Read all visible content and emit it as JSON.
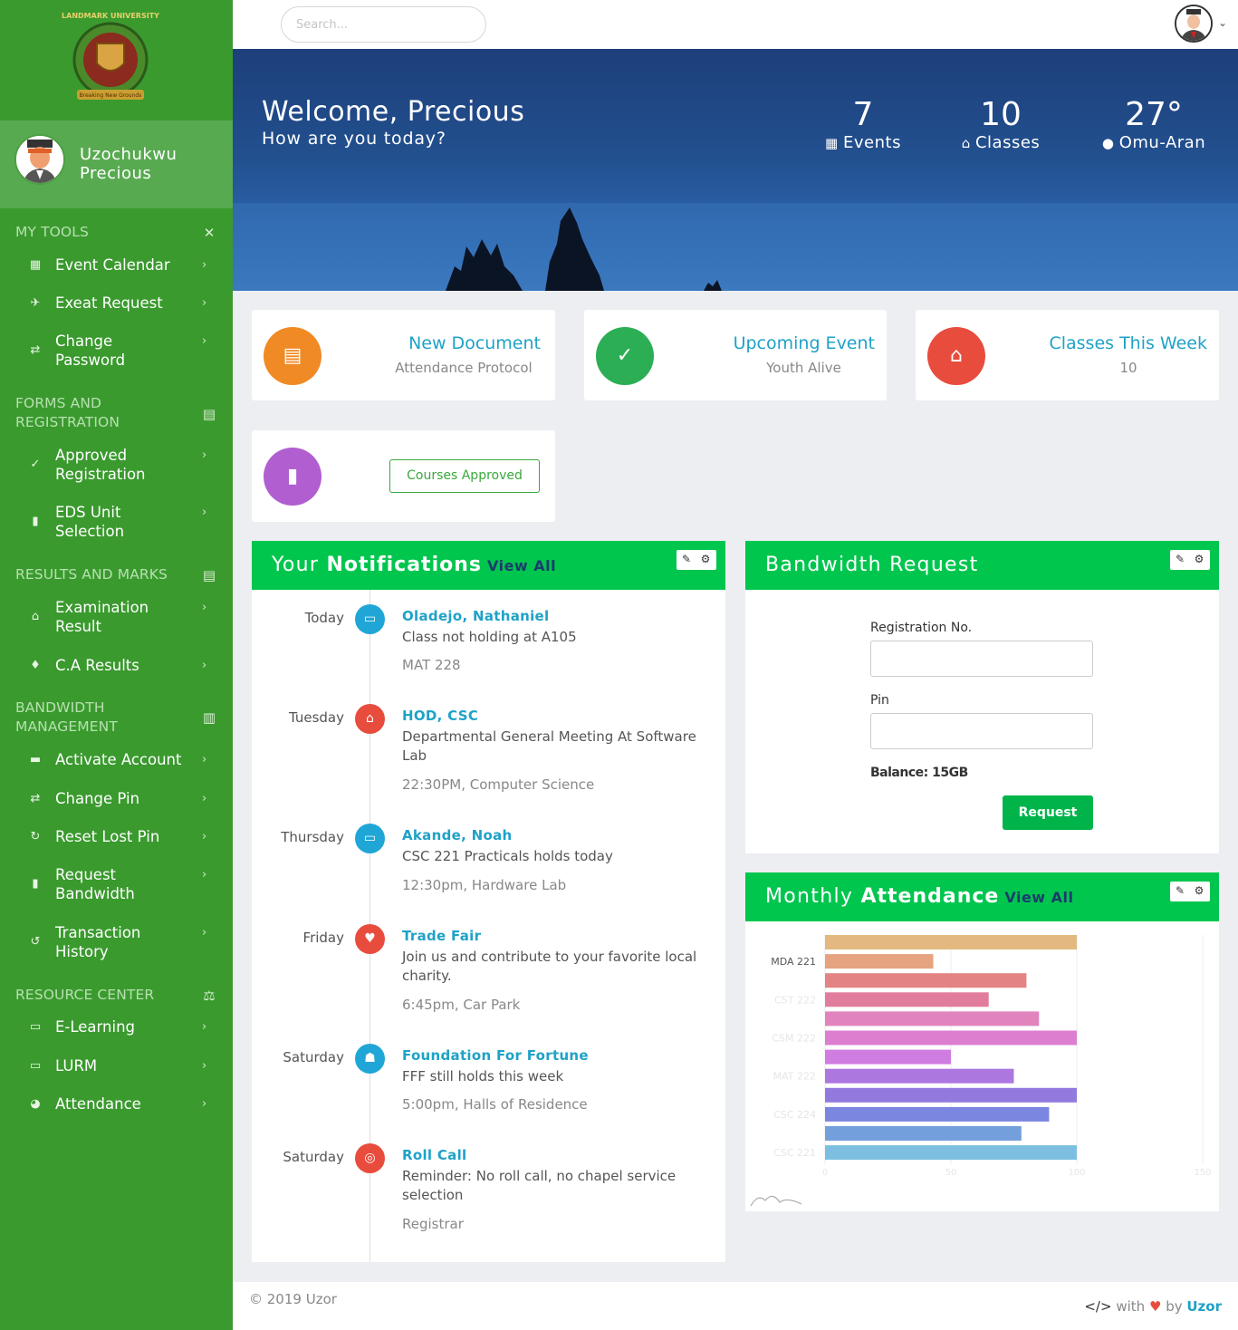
{
  "topbar": {
    "search_placeholder": "Search..."
  },
  "sidebar": {
    "logo_text": "LANDMARK UNIVERSITY",
    "logo_motto": "Breaking New Grounds",
    "user_first": "Uzochukwu",
    "user_last": "Precious",
    "sections": [
      {
        "title": "MY TOOLS",
        "icon": "tools-icon",
        "items": [
          {
            "label": "Event Calendar",
            "icon": "calendar-icon"
          },
          {
            "label": "Exeat Request",
            "icon": "plane-icon"
          },
          {
            "label": "Change Password",
            "icon": "exchange-icon"
          }
        ]
      },
      {
        "title": "FORMS AND REGISTRATION",
        "icon": "form-icon",
        "items": [
          {
            "label": "Approved Registration",
            "icon": "check-circle-icon"
          },
          {
            "label": "EDS Unit Selection",
            "icon": "clipboard-icon"
          }
        ]
      },
      {
        "title": "RESULTS AND MARKS",
        "icon": "document-icon",
        "items": [
          {
            "label": "Examination Result",
            "icon": "graduation-cap-icon"
          },
          {
            "label": "C.A Results",
            "icon": "award-icon"
          }
        ]
      },
      {
        "title": "BANDWIDTH MANAGEMENT",
        "icon": "bar-chart-icon",
        "items": [
          {
            "label": "Activate Account",
            "icon": "card-icon"
          },
          {
            "label": "Change Pin",
            "icon": "exchange-icon"
          },
          {
            "label": "Reset Lost Pin",
            "icon": "redo-icon"
          },
          {
            "label": "Request Bandwidth",
            "icon": "clipboard-check-icon"
          },
          {
            "label": "Transaction History",
            "icon": "history-icon"
          }
        ]
      },
      {
        "title": "RESOURCE CENTER",
        "icon": "balance-scale-icon",
        "items": [
          {
            "label": "E-Learning",
            "icon": "chalkboard-icon"
          },
          {
            "label": "LURM",
            "icon": "laptop-icon"
          },
          {
            "label": "Attendance",
            "icon": "pie-chart-icon"
          }
        ]
      }
    ]
  },
  "banner": {
    "welcome": "Welcome, Precious",
    "subtitle": "How are you today?",
    "stats": [
      {
        "value": "7",
        "label": "Events",
        "icon": "calendar-icon"
      },
      {
        "value": "10",
        "label": "Classes",
        "icon": "university-icon"
      },
      {
        "value": "27°",
        "label": "Omu-Aran",
        "icon": "map-marker-icon"
      }
    ]
  },
  "cards": [
    {
      "title": "New Document",
      "subtitle": "Attendance Protocol",
      "icon": "file-icon",
      "color": "#f08a24"
    },
    {
      "title": "Upcoming Event",
      "subtitle": "Youth Alive",
      "icon": "calendar-check-icon",
      "color": "#2cae55"
    },
    {
      "title": "Classes This Week",
      "subtitle": "10",
      "icon": "university-icon",
      "color": "#e84c3d"
    },
    {
      "button": "Courses Approved",
      "icon": "book-icon",
      "color": "#b05ed0"
    }
  ],
  "notifications": {
    "title_light": "Your",
    "title_bold": "Notifications",
    "view_all": "View All",
    "items": [
      {
        "day": "Today",
        "name": "Oladejo, Nathaniel",
        "desc": "Class not holding at A105",
        "meta": "MAT 228",
        "icon": "chalkboard-teacher-icon",
        "color": "#1fa6d6"
      },
      {
        "day": "Tuesday",
        "name": "HOD, CSC",
        "desc": "Departmental General Meeting At Software Lab",
        "meta": "22:30PM, Computer Science",
        "icon": "university-icon",
        "color": "#e84c3d"
      },
      {
        "day": "Thursday",
        "name": "Akande, Noah",
        "desc": "CSC 221 Practicals holds today",
        "meta": "12:30pm, Hardware Lab",
        "icon": "laptop-icon",
        "color": "#1fa6d6"
      },
      {
        "day": "Friday",
        "name": "Trade Fair",
        "desc": "Join us and contribute to your favorite local charity.",
        "meta": "6:45pm, Car Park",
        "icon": "heart-icon",
        "color": "#e84c3d"
      },
      {
        "day": "Saturday",
        "name": "Foundation For Fortune",
        "desc": "FFF still holds this week",
        "meta": "5:00pm, Halls of Residence",
        "icon": "sitemap-icon",
        "color": "#1fa6d6"
      },
      {
        "day": "Saturday",
        "name": "Roll Call",
        "desc": "Reminder: No roll call, no chapel service selection",
        "meta": "Registrar",
        "icon": "fingerprint-icon",
        "color": "#e84c3d"
      }
    ]
  },
  "bandwidth": {
    "title": "Bandwidth Request",
    "reg_label": "Registration No.",
    "pin_label": "Pin",
    "balance": "Balance: 15GB",
    "button": "Request"
  },
  "attendance": {
    "title_light": "Monthly",
    "title_bold": "Attendance",
    "view_all": "View All"
  },
  "chart_data": {
    "type": "bar",
    "orientation": "horizontal",
    "categories": [
      "",
      "MDA 221",
      "",
      "CST 222",
      "",
      "CSM 222",
      "",
      "MAT 222",
      "",
      "CSC 224",
      "",
      "CSC 221"
    ],
    "values": [
      100,
      43,
      80,
      65,
      85,
      100,
      50,
      75,
      100,
      89,
      78,
      100
    ],
    "colors": [
      "#e3b981",
      "#e5a37f",
      "#e48383",
      "#e27c9d",
      "#e184bd",
      "#dd7fcf",
      "#cf7de0",
      "#ac78e0",
      "#9279de",
      "#7b86e0",
      "#73a0dd",
      "#7cbfe0"
    ],
    "xlim": [
      0,
      150
    ],
    "xticks": [
      "0",
      "50",
      "100",
      "150"
    ],
    "grid": true
  },
  "footer": {
    "copyright": "© 2019 Uzor",
    "made_with": "with",
    "by": "by",
    "author": "Uzor"
  }
}
